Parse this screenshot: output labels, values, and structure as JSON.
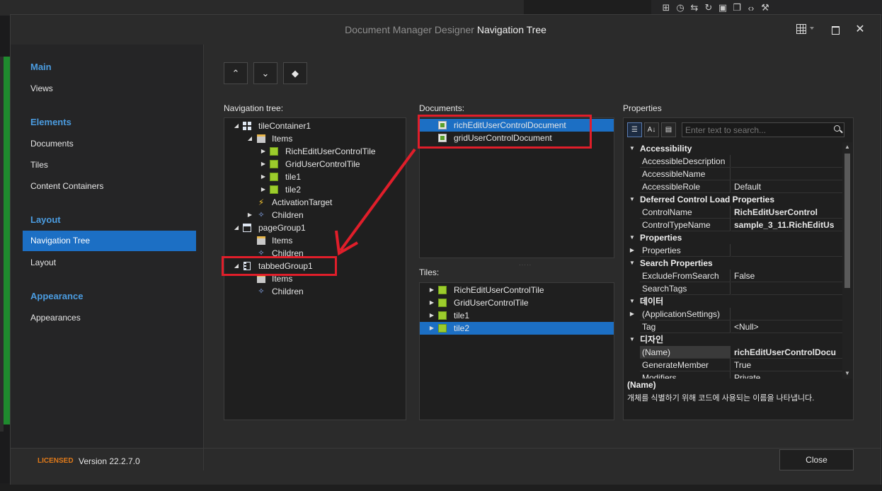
{
  "window": {
    "title_prefix": "Document Manager Designer",
    "title_main": "Navigation Tree",
    "close_glyph": "✕"
  },
  "sidebar": {
    "sections": [
      {
        "header": "Main",
        "items": [
          "Views"
        ]
      },
      {
        "header": "Elements",
        "items": [
          "Documents",
          "Tiles",
          "Content Containers"
        ]
      },
      {
        "header": "Layout",
        "items": [
          "Navigation Tree",
          "Layout"
        ]
      },
      {
        "header": "Appearance",
        "items": [
          "Appearances"
        ]
      }
    ],
    "selected": "Navigation Tree"
  },
  "toolbar": {
    "move_up_glyph": "⌃",
    "move_down_glyph": "⌄",
    "clear_glyph": "◆"
  },
  "navtree": {
    "label": "Navigation tree:",
    "rows": [
      {
        "text": "tileContainer1",
        "icon": "tile-container-icon",
        "expander": "◢"
      },
      {
        "text": "Items",
        "icon": "items-icon",
        "expander": "◢"
      },
      {
        "text": "RichEditUserControlTile",
        "icon": "tile-icon",
        "expander": "▶"
      },
      {
        "text": "GridUserControlTile",
        "icon": "tile-icon",
        "expander": "▶"
      },
      {
        "text": "tile1",
        "icon": "tile-icon",
        "expander": "▶"
      },
      {
        "text": "tile2",
        "icon": "tile-icon",
        "expander": "▶"
      },
      {
        "text": "ActivationTarget",
        "icon": "activation-icon",
        "expander": ""
      },
      {
        "text": "Children",
        "icon": "children-icon",
        "expander": "▶"
      },
      {
        "text": "pageGroup1",
        "icon": "page-group-icon",
        "expander": "◢"
      },
      {
        "text": "Items",
        "icon": "items-icon",
        "expander": ""
      },
      {
        "text": "Children",
        "icon": "children-icon",
        "expander": ""
      },
      {
        "text": "tabbedGroup1",
        "icon": "tabbed-group-icon",
        "expander": "◢"
      },
      {
        "text": "Items",
        "icon": "items-icon",
        "expander": ""
      },
      {
        "text": "Children",
        "icon": "children-icon",
        "expander": ""
      }
    ]
  },
  "documents": {
    "label": "Documents:",
    "rows": [
      "richEditUserControlDocument",
      "gridUserControlDocument"
    ],
    "selected": "richEditUserControlDocument"
  },
  "tiles": {
    "label": "Tiles:",
    "rows": [
      "RichEditUserControlTile",
      "GridUserControlTile",
      "tile1",
      "tile2"
    ],
    "selected": "tile2"
  },
  "properties": {
    "label": "Properties",
    "search_placeholder": "Enter text to search...",
    "rows": [
      {
        "type": "cat",
        "name": "Accessibility"
      },
      {
        "type": "prop",
        "name": "AccessibleDescription",
        "value": ""
      },
      {
        "type": "prop",
        "name": "AccessibleName",
        "value": ""
      },
      {
        "type": "prop",
        "name": "AccessibleRole",
        "value": "Default"
      },
      {
        "type": "cat",
        "name": "Deferred Control Load Properties"
      },
      {
        "type": "prop",
        "name": "ControlName",
        "value": "RichEditUserControl",
        "bold": true
      },
      {
        "type": "prop",
        "name": "ControlTypeName",
        "value": "sample_3_11.RichEditUs",
        "bold": true
      },
      {
        "type": "cat",
        "name": "Properties"
      },
      {
        "type": "prop",
        "name": "Properties",
        "value": "",
        "expander": "▶"
      },
      {
        "type": "cat",
        "name": "Search Properties"
      },
      {
        "type": "prop",
        "name": "ExcludeFromSearch",
        "value": "False"
      },
      {
        "type": "prop",
        "name": "SearchTags",
        "value": ""
      },
      {
        "type": "cat",
        "name": "데이터"
      },
      {
        "type": "prop",
        "name": "(ApplicationSettings)",
        "value": "",
        "expander": "▶"
      },
      {
        "type": "prop",
        "name": "Tag",
        "value": "<Null>"
      },
      {
        "type": "cat",
        "name": "디자인"
      },
      {
        "type": "prop",
        "name": "(Name)",
        "value": "richEditUserControlDocu",
        "bold": true,
        "highlight": true
      },
      {
        "type": "prop",
        "name": "GenerateMember",
        "value": "True"
      },
      {
        "type": "prop",
        "name": "Modifiers",
        "value": "Private"
      }
    ],
    "description_title": "(Name)",
    "description_text": "개체를 식별하기 위해 코드에 사용되는 이름을 나타냅니다."
  },
  "footer": {
    "licensed": "LICENSED",
    "version": "Version 22.2.7.0",
    "close_label": "Close"
  },
  "colors": {
    "accent": "#1c6fc4",
    "section_header": "#4b9ce0",
    "licensed": "#e07a1a",
    "annotation": "#e01e2a"
  }
}
